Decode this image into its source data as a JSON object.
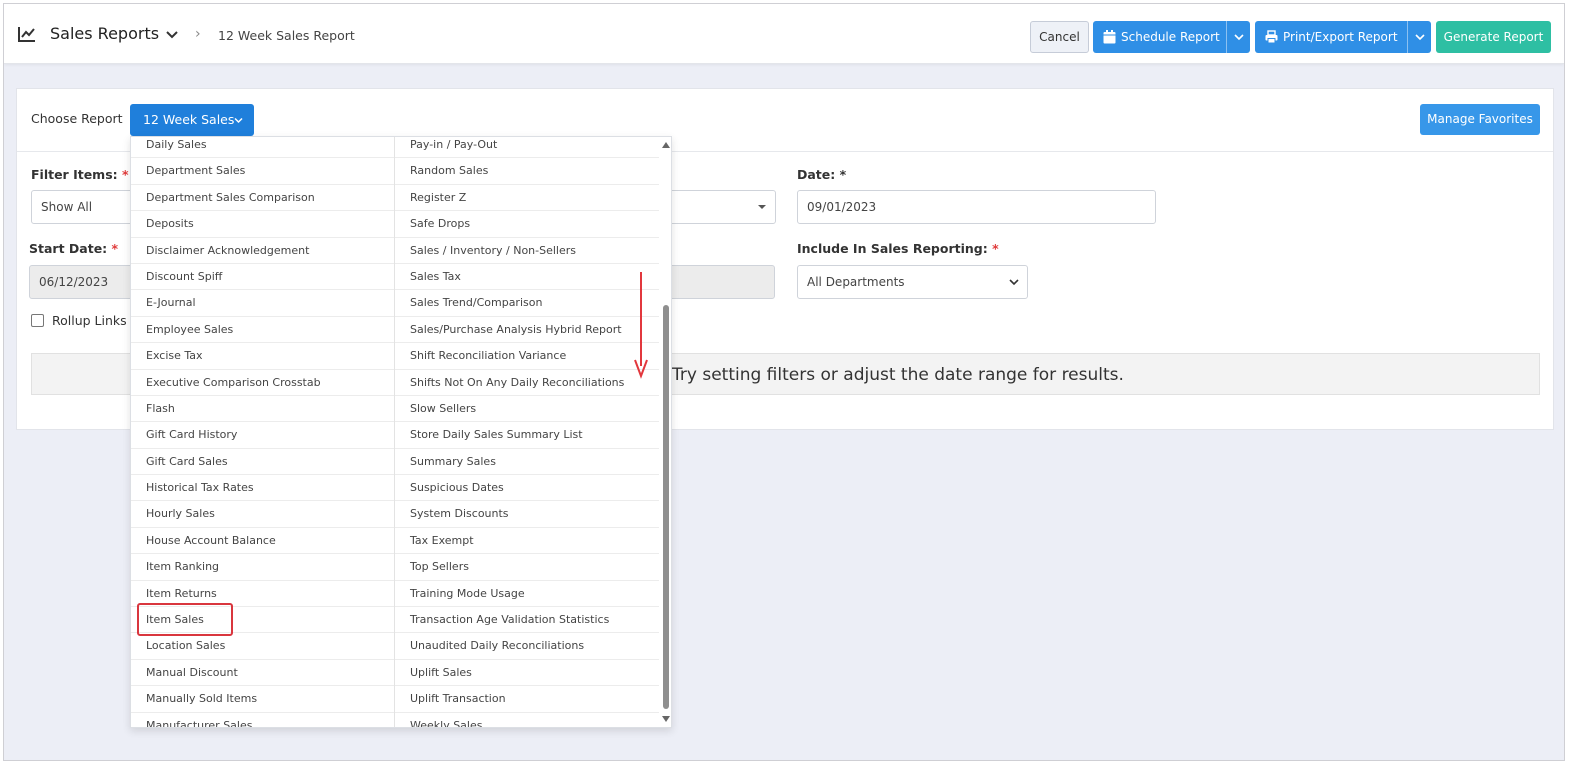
{
  "header": {
    "title": "Sales Reports",
    "breadcrumb": "12 Week Sales Report",
    "cancel_label": "Cancel",
    "schedule_label": "Schedule Report",
    "print_label": "Print/Export Report",
    "generate_label": "Generate Report"
  },
  "panel": {
    "choose_label": "Choose Report",
    "selected_report": "12 Week Sales",
    "favorites_label": "Manage Favorites",
    "filter_items_label": "Filter Items:",
    "filter_items_value": "Show All",
    "date_label": "Date:",
    "date_value": "09/01/2023",
    "start_date_label": "Start Date:",
    "start_date_value": "06/12/2023",
    "include_label": "Include In Sales Reporting:",
    "include_value": "All Departments",
    "rollup_label": "Rollup Links",
    "message": "Try setting filters or adjust the date range for results.",
    "required_mark": "*"
  },
  "dropdown": {
    "left_options": [
      "Daily Sales",
      "Department Sales",
      "Department Sales Comparison",
      "Deposits",
      "Disclaimer Acknowledgement",
      "Discount Spiff",
      "E-Journal",
      "Employee Sales",
      "Excise Tax",
      "Executive Comparison Crosstab",
      "Flash",
      "Gift Card History",
      "Gift Card Sales",
      "Historical Tax Rates",
      "Hourly Sales",
      "House Account Balance",
      "Item Ranking",
      "Item Returns",
      "Item Sales",
      "Location Sales",
      "Manual Discount",
      "Manually Sold Items",
      "Manufacturer Sales"
    ],
    "right_options": [
      "Pay-in / Pay-Out",
      "Random Sales",
      "Register Z",
      "Safe Drops",
      "Sales / Inventory / Non-Sellers",
      "Sales Tax",
      "Sales Trend/Comparison",
      "Sales/Purchase Analysis Hybrid Report",
      "Shift Reconciliation Variance",
      "Shifts Not On Any Daily Reconciliations",
      "Slow Sellers",
      "Store Daily Sales Summary List",
      "Summary Sales",
      "Suspicious Dates",
      "System Discounts",
      "Tax Exempt",
      "Top Sellers",
      "Training Mode Usage",
      "Transaction Age Validation Statistics",
      "Unaudited Daily Reconciliations",
      "Uplift Sales",
      "Uplift Transaction",
      "Weekly Sales"
    ],
    "highlighted": "Item Sales"
  },
  "colors": {
    "primary": "#2f8fe6",
    "generate": "#2ebfa3",
    "highlight": "#d9363e"
  }
}
